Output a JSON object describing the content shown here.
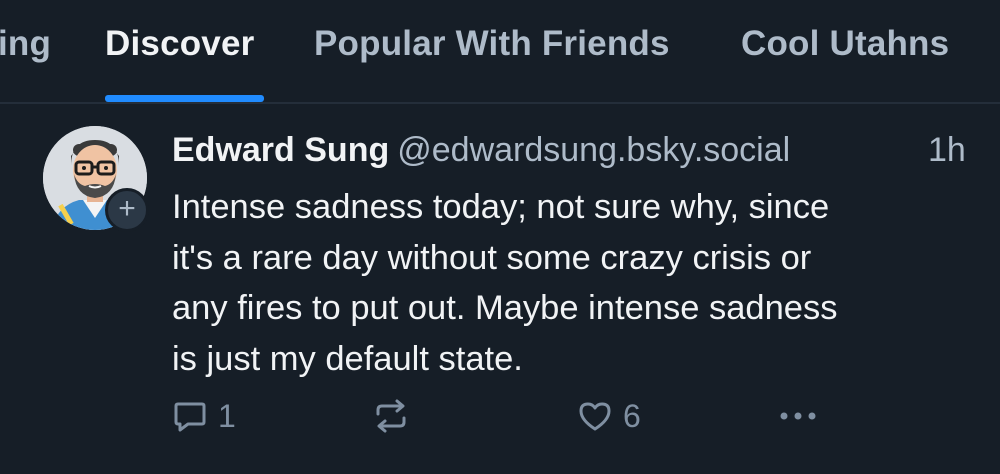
{
  "tabs": [
    {
      "label": "ing",
      "active": false
    },
    {
      "label": "Discover",
      "active": true
    },
    {
      "label": "Popular With Friends",
      "active": false
    },
    {
      "label": "Cool Utahns",
      "active": false
    }
  ],
  "post": {
    "author_name": "Edward Sung",
    "author_handle": "@edwardsung.bsky.social",
    "timestamp": "1h",
    "text_lines": [
      "Intense sadness today; not sure why, since",
      "it's a rare day without some crazy crisis or",
      "any fires to put out. Maybe intense sadness",
      "is just my default state."
    ],
    "follow_label": "+",
    "reply_count": "1",
    "like_count": "6",
    "icons": {
      "reply": "reply-icon",
      "repost": "repost-icon",
      "like": "heart-icon",
      "more": "more-options-icon"
    }
  },
  "colors": {
    "background": "#161e27",
    "accent": "#208bfe",
    "text_primary": "#f1f3f5",
    "text_secondary": "#aebbc9",
    "icon_muted": "#7f8fa1"
  }
}
